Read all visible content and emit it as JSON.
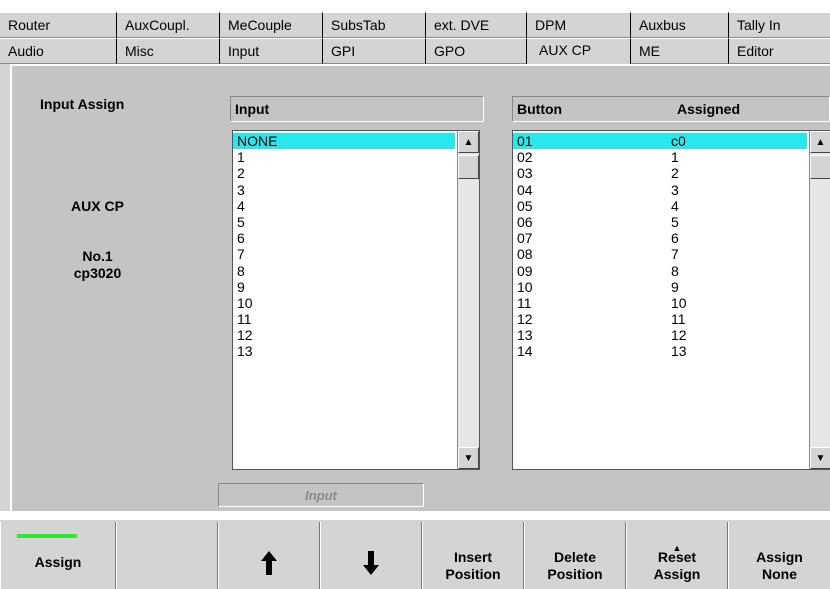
{
  "tabs_row1": [
    {
      "label": "Router"
    },
    {
      "label": "AuxCoupl."
    },
    {
      "label": "MeCouple"
    },
    {
      "label": "SubsTab"
    },
    {
      "label": "ext. DVE"
    },
    {
      "label": "DPM"
    },
    {
      "label": "Auxbus"
    },
    {
      "label": "Tally In"
    }
  ],
  "tabs_row2": [
    {
      "label": "Audio"
    },
    {
      "label": "Misc"
    },
    {
      "label": "Input"
    },
    {
      "label": "GPI"
    },
    {
      "label": "GPO"
    },
    {
      "label": "AUX CP",
      "active": true
    },
    {
      "label": "ME"
    },
    {
      "label": "Editor"
    }
  ],
  "left": {
    "title": "Input Assign",
    "device": "AUX CP",
    "number": "No.1",
    "model": "cp3020"
  },
  "input_list": {
    "header": "Input",
    "rows": [
      "NONE",
      "1",
      "2",
      "3",
      "4",
      "5",
      "6",
      "7",
      "8",
      "9",
      "10",
      "11",
      "12",
      "13"
    ],
    "selected_index": 0
  },
  "assign_list": {
    "header_button": "Button",
    "header_assigned": "Assigned",
    "rows": [
      {
        "button": "01",
        "assigned": "c0"
      },
      {
        "button": "02",
        "assigned": "1"
      },
      {
        "button": "03",
        "assigned": "2"
      },
      {
        "button": "04",
        "assigned": "3"
      },
      {
        "button": "05",
        "assigned": "4"
      },
      {
        "button": "06",
        "assigned": "5"
      },
      {
        "button": "07",
        "assigned": "6"
      },
      {
        "button": "08",
        "assigned": "7"
      },
      {
        "button": "09",
        "assigned": "8"
      },
      {
        "button": "10",
        "assigned": "9"
      },
      {
        "button": "11",
        "assigned": "10"
      },
      {
        "button": "12",
        "assigned": "11"
      },
      {
        "button": "13",
        "assigned": "12"
      },
      {
        "button": "14",
        "assigned": "13"
      }
    ],
    "selected_index": 0
  },
  "input_field_label": "Input",
  "buttons": {
    "assign": {
      "line1": "Assign",
      "icon": "active-indicator"
    },
    "blank": {
      "line1": ""
    },
    "up": {
      "icon": "arrow-up-icon",
      "glyph": "🡅"
    },
    "down": {
      "icon": "arrow-down-icon",
      "glyph": "🡇"
    },
    "insert": {
      "line1": "Insert",
      "line2": "Position"
    },
    "delete": {
      "line1": "Delete",
      "line2": "Position"
    },
    "reset": {
      "line1": "Reset",
      "line2": "Assign",
      "icon": "triangle-up-icon"
    },
    "assign_none": {
      "line1": "Assign",
      "line2": "None"
    }
  },
  "colors": {
    "selection": "#27e8ec",
    "panel": "#c4c4c4",
    "active_indicator": "#2be82b"
  }
}
